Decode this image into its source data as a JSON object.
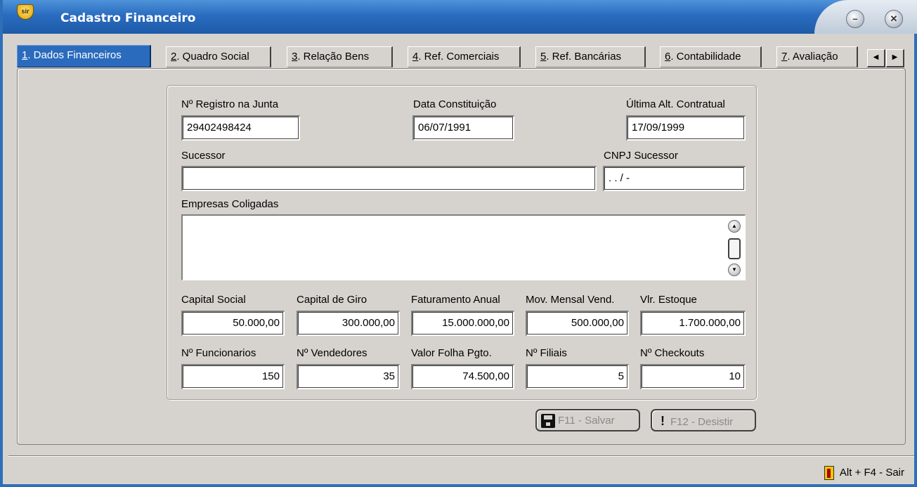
{
  "window": {
    "title": "Cadastro Financeiro",
    "icon": "sir-app-icon",
    "app_badge": "sir"
  },
  "tabs": [
    {
      "key": "1",
      "label": ". Dados Financeiros",
      "active": true
    },
    {
      "key": "2",
      "label": ". Quadro Social"
    },
    {
      "key": "3",
      "label": ". Relação Bens"
    },
    {
      "key": "4",
      "label": ". Ref. Comerciais"
    },
    {
      "key": "5",
      "label": ". Ref. Bancárias"
    },
    {
      "key": "6",
      "label": ". Contabilidade"
    },
    {
      "key": "7",
      "label": ". Avaliação"
    }
  ],
  "form": {
    "registro": {
      "label": "Nº Registro na Junta",
      "value": "29402498424"
    },
    "constituicao": {
      "label": "Data Constituição",
      "value": "06/07/1991"
    },
    "ultima_alt": {
      "label": "Última Alt. Contratual",
      "value": "17/09/1999"
    },
    "sucessor": {
      "label": "Sucessor",
      "value": ""
    },
    "cnpj_sucessor": {
      "label": "CNPJ Sucessor",
      "value": " .  .  /  -"
    },
    "coligadas": {
      "label": "Empresas Coligadas",
      "value": ""
    },
    "capital_social": {
      "label": "Capital Social",
      "value": "50.000,00"
    },
    "capital_giro": {
      "label": "Capital de Giro",
      "value": "300.000,00"
    },
    "faturamento": {
      "label": "Faturamento Anual",
      "value": "15.000.000,00"
    },
    "mov_mensal": {
      "label": "Mov. Mensal Vend.",
      "value": "500.000,00"
    },
    "estoque": {
      "label": "Vlr. Estoque",
      "value": "1.700.000,00"
    },
    "funcionarios": {
      "label": "Nº Funcionarios",
      "value": "150"
    },
    "vendedores": {
      "label": "Nº Vendedores",
      "value": "35"
    },
    "folha": {
      "label": "Valor Folha Pgto.",
      "value": "74.500,00"
    },
    "filiais": {
      "label": "Nº Filiais",
      "value": "5"
    },
    "checkouts": {
      "label": "Nº Checkouts",
      "value": "10"
    }
  },
  "buttons": {
    "save": "F11 - Salvar",
    "cancel": "F12 - Desistir"
  },
  "status": {
    "exit": "Alt + F4 - Sair"
  },
  "colors": {
    "title_bar": "#2a6cc0",
    "active_tab": "#2a6bbd",
    "window_bg": "#d6d3ce"
  }
}
